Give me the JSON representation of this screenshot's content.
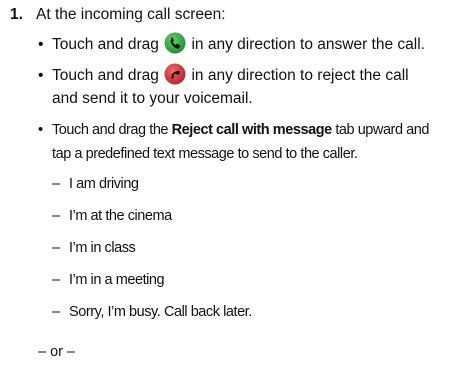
{
  "step": {
    "number": "1.",
    "text": "At the incoming call screen:"
  },
  "bullets": [
    {
      "before": "Touch and drag",
      "icon": "answer-call-icon",
      "after": "in any direction to answer the call."
    },
    {
      "before": "Touch and drag",
      "icon": "reject-call-icon",
      "after": "in any direction to reject the call",
      "line2": "and send it to your voicemail."
    },
    {
      "before": "Touch and drag the",
      "bold": "Reject call with message",
      "after": "tab upward and",
      "line2": "tap a predefined text message to send to the caller."
    }
  ],
  "messages": [
    "I am driving",
    "I’m at the cinema",
    "I’m in class",
    "I’m in a meeting",
    "Sorry, I’m busy. Call back later."
  ],
  "dash": "–",
  "bullet_char": "•",
  "or_text": "– or –",
  "colors": {
    "answer_icon": "#2e9e3e",
    "reject_icon": "#d6383b"
  }
}
